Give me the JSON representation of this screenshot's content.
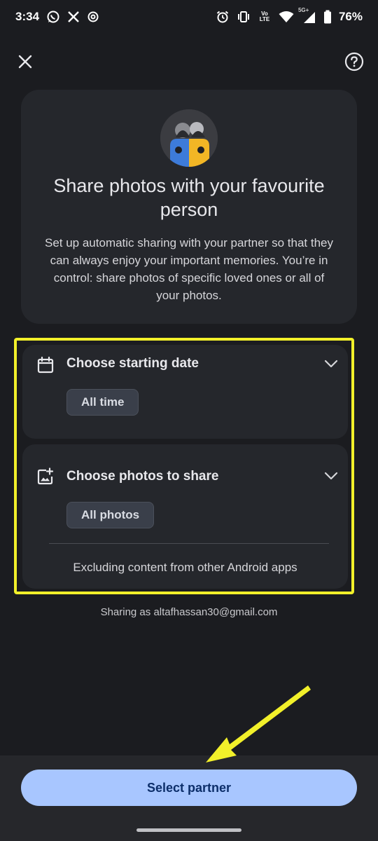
{
  "status_bar": {
    "time": "3:34",
    "battery": "76%",
    "left_icons": [
      "whatsapp-icon",
      "x-icon",
      "threads-icon"
    ],
    "right_icons": [
      "alarm-icon",
      "vibrate-icon",
      "volte-icon",
      "wifi-icon",
      "5g-signal-icon",
      "battery-icon"
    ],
    "volte_label": "Vo LTE",
    "net_label": "5G+"
  },
  "top_bar": {
    "close_icon": "close-icon",
    "help_icon": "help-icon"
  },
  "intro": {
    "title": "Share photos with your favourite person",
    "description": "Set up automatic sharing with your partner so that they can always enjoy your important memories. You’re in control: share photos of specific loved ones or all of your photos."
  },
  "options": {
    "date": {
      "icon": "calendar-icon",
      "title": "Choose starting date",
      "value": "All time"
    },
    "photos": {
      "icon": "add-photo-icon",
      "title": "Choose photos to share",
      "value": "All photos",
      "note": "Excluding content from other Android apps"
    }
  },
  "sharing_as": "Sharing as altafhassan30@gmail.com",
  "primary_button": "Select partner",
  "colors": {
    "background": "#1b1c20",
    "card": "#25272c",
    "primary": "#a8c6ff",
    "highlight": "#f2f02a"
  }
}
